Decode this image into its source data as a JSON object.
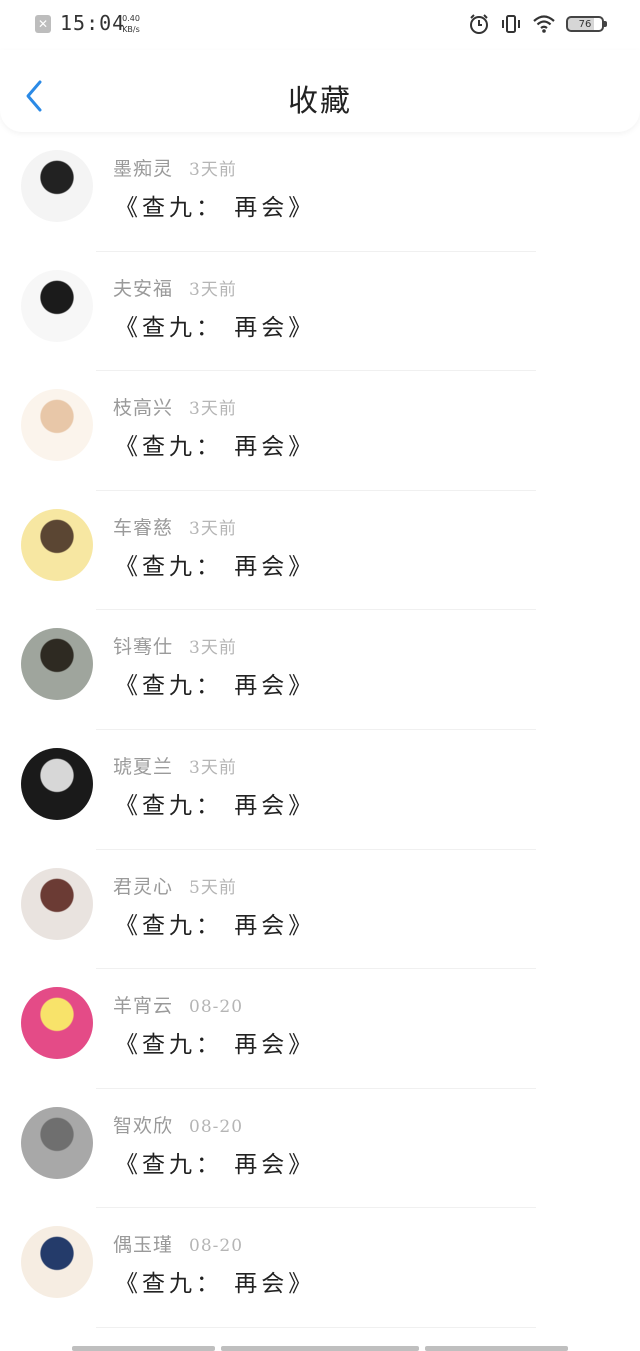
{
  "status_bar": {
    "close_icon": "✕",
    "time": "15:04",
    "speed_value": "0.40",
    "speed_unit": "KB/s",
    "battery": "76"
  },
  "header": {
    "back_icon": "chevron-left-icon",
    "title": "收藏"
  },
  "items": [
    {
      "name": "墨痴灵",
      "time": "3天前",
      "title": "《查九： 再会》",
      "avatar_colors": [
        "#f4f4f4",
        "#222222"
      ]
    },
    {
      "name": "夫安福",
      "time": "3天前",
      "title": "《查九： 再会》",
      "avatar_colors": [
        "#f7f7f7",
        "#1b1b1b"
      ]
    },
    {
      "name": "枝高兴",
      "time": "3天前",
      "title": "《查九： 再会》",
      "avatar_colors": [
        "#fbf4ec",
        "#e8c7a8"
      ]
    },
    {
      "name": "车睿慈",
      "time": "3天前",
      "title": "《查九： 再会》",
      "avatar_colors": [
        "#f7e7a2",
        "#5b4633"
      ]
    },
    {
      "name": "钭骞仕",
      "time": "3天前",
      "title": "《查九： 再会》",
      "avatar_colors": [
        "#9fa59d",
        "#2e2a22"
      ]
    },
    {
      "name": "琥夏兰",
      "time": "3天前",
      "title": "《查九： 再会》",
      "avatar_colors": [
        "#1a1a1a",
        "#d7d7d7"
      ]
    },
    {
      "name": "君灵心",
      "time": "5天前",
      "title": "《查九： 再会》",
      "avatar_colors": [
        "#e9e3df",
        "#6b3b34"
      ]
    },
    {
      "name": "羊宵云",
      "time": "08-20",
      "title": "《查九： 再会》",
      "avatar_colors": [
        "#e44b87",
        "#f8e36a"
      ]
    },
    {
      "name": "智欢欣",
      "time": "08-20",
      "title": "《查九： 再会》",
      "avatar_colors": [
        "#a8a8a8",
        "#6f6f6f"
      ]
    },
    {
      "name": "偶玉瑾",
      "time": "08-20",
      "title": "《查九： 再会》",
      "avatar_colors": [
        "#f6ede2",
        "#243b6a"
      ]
    }
  ]
}
